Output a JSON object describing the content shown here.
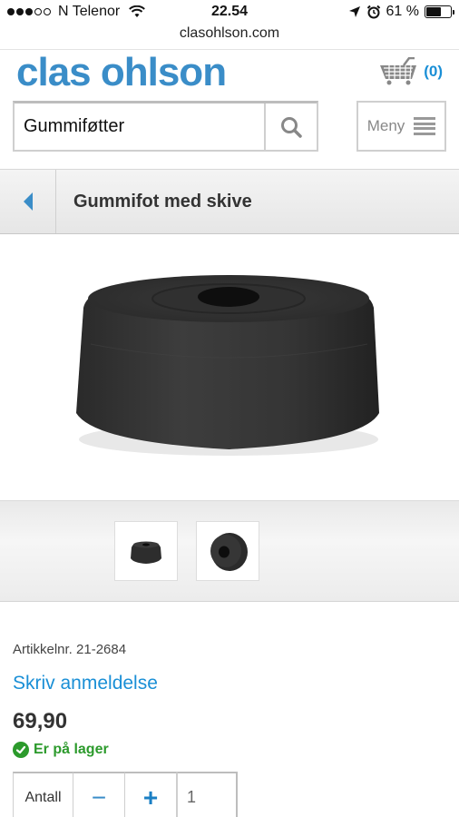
{
  "status_bar": {
    "carrier": "N Telenor",
    "time": "22.54",
    "battery": "61 %",
    "battery_level": 0.61,
    "signal_bars_filled": 3,
    "signal_bars_total": 5
  },
  "browser": {
    "url": "clasohlson.com"
  },
  "header": {
    "logo": "clas ohlson",
    "cart_count": "(0)",
    "search_value": "Gummiføtter",
    "menu_label": "Meny"
  },
  "page": {
    "title": "Gummifot med skive"
  },
  "product": {
    "article_number": "Artikkelnr. 21-2684",
    "review_link": "Skriv anmeldelse",
    "price": "69,90",
    "stock_status": "Er på lager",
    "quantity_label": "Antall",
    "quantity_value": "1",
    "minus_label": "−",
    "plus_label": "+"
  },
  "colors": {
    "brand_blue": "#3a8dc8",
    "link_blue": "#1a8fd6",
    "stock_green": "#2c9a2c"
  },
  "icons": [
    "wifi-icon",
    "location-arrow-icon",
    "alarm-icon",
    "battery-icon",
    "cart-icon",
    "search-icon",
    "hamburger-menu-icon",
    "back-chevron-icon",
    "checkmark-icon"
  ]
}
